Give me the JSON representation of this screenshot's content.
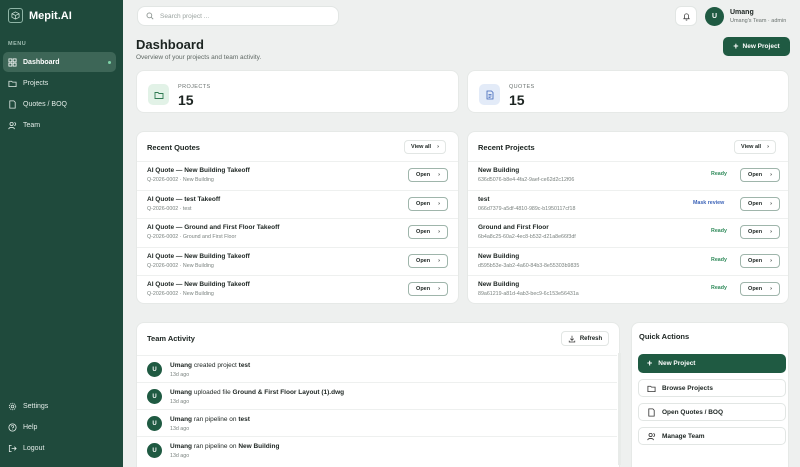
{
  "brand": {
    "name": "Mepit.AI"
  },
  "sidebar": {
    "menu_label": "MENU",
    "items": [
      {
        "label": "Dashboard",
        "active": true
      },
      {
        "label": "Projects"
      },
      {
        "label": "Quotes / BOQ"
      },
      {
        "label": "Team"
      }
    ],
    "footer": [
      {
        "label": "Settings"
      },
      {
        "label": "Help"
      },
      {
        "label": "Logout"
      }
    ]
  },
  "topbar": {
    "search_placeholder": "Search project ...",
    "user": {
      "initial": "U",
      "name": "Umang",
      "subtitle": "Umang's Team · admin"
    }
  },
  "header": {
    "title": "Dashboard",
    "subtitle": "Overview of your projects and team activity.",
    "new_project_label": "New Project"
  },
  "stats": {
    "projects": {
      "label": "PROJECTS",
      "value": "15"
    },
    "quotes": {
      "label": "QUOTES",
      "value": "15"
    }
  },
  "recent_quotes": {
    "title": "Recent Quotes",
    "view_all": "View all",
    "open_label": "Open",
    "rows": [
      {
        "title": "AI Quote — New Building Takeoff",
        "sub": "Q-2026-0002 · New Building"
      },
      {
        "title": "AI Quote — test Takeoff",
        "sub": "Q-2026-0002 · test"
      },
      {
        "title": "AI Quote — Ground and First Floor Takeoff",
        "sub": "Q-2026-0002 · Ground and First Floor"
      },
      {
        "title": "AI Quote — New Building Takeoff",
        "sub": "Q-2026-0002 · New Building"
      },
      {
        "title": "AI Quote — New Building Takeoff",
        "sub": "Q-2026-0002 · New Building"
      }
    ]
  },
  "recent_projects": {
    "title": "Recent Projects",
    "view_all": "View all",
    "open_label": "Open",
    "rows": [
      {
        "title": "New Building",
        "sub": "636d5076-b8e4-4fa2-9aef-ce62d2c12f06",
        "status": "Ready",
        "kind": "ready"
      },
      {
        "title": "test",
        "sub": "066d7379-a5df-4810-989c-b1950117cf18",
        "status": "Mask review",
        "kind": "mask"
      },
      {
        "title": "Ground and First Floor",
        "sub": "6b4a8c25-60a2-4ec8-b532-d21a8e66f3df",
        "status": "Ready",
        "kind": "ready"
      },
      {
        "title": "New Building",
        "sub": "d595b53e-3ab2-4a60-84b3-8e55303b9835",
        "status": "Ready",
        "kind": "ready"
      },
      {
        "title": "New Building",
        "sub": "89a61219-a81d-4ab3-bec9-6c153e56431a",
        "status": "Ready",
        "kind": "ready"
      }
    ]
  },
  "team_activity": {
    "title": "Team Activity",
    "refresh_label": "Refresh",
    "rows": [
      {
        "initial": "U",
        "user": "Umang",
        "action": "created project",
        "target": "test",
        "time": "13d ago"
      },
      {
        "initial": "U",
        "user": "Umang",
        "action": "uploaded file",
        "target": "Ground & First Floor Layout (1).dwg",
        "time": "13d ago"
      },
      {
        "initial": "U",
        "user": "Umang",
        "action": "ran pipeline on",
        "target": "test",
        "time": "13d ago"
      },
      {
        "initial": "U",
        "user": "Umang",
        "action": "ran pipeline on",
        "target": "New Building",
        "time": "13d ago"
      }
    ]
  },
  "quick_actions": {
    "title": "Quick Actions",
    "items": [
      {
        "label": "New Project",
        "icon": "plus-icon"
      },
      {
        "label": "Browse Projects",
        "icon": "folder-icon"
      },
      {
        "label": "Open Quotes / BOQ",
        "icon": "document-icon"
      },
      {
        "label": "Manage Team",
        "icon": "users-icon"
      }
    ]
  },
  "colors": {
    "sidebar": "#1f4a3c",
    "accent": "#1f5a42",
    "ready": "#2f8a5a",
    "mask_review": "#3d64b8"
  }
}
